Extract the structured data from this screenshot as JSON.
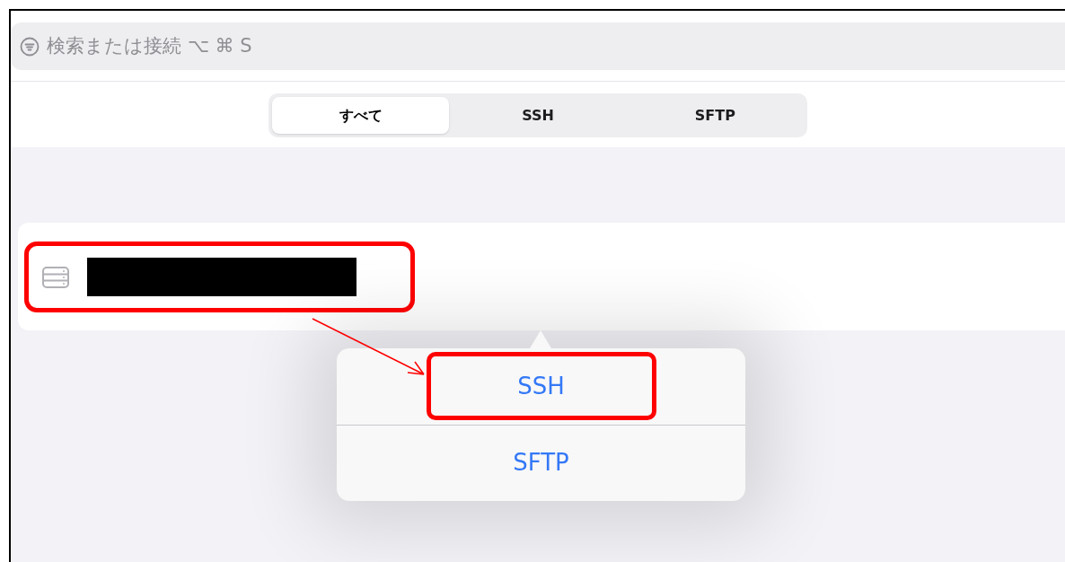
{
  "search": {
    "placeholder": "検索または接続 ⌥ ⌘ S"
  },
  "tabs": [
    {
      "label": "すべて",
      "selected": true
    },
    {
      "label": "SSH",
      "selected": false
    },
    {
      "label": "SFTP",
      "selected": false
    }
  ],
  "host_row": {
    "redacted": true,
    "annotated": true
  },
  "menu": {
    "items": [
      {
        "label": "SSH",
        "annotated": true
      },
      {
        "label": "SFTP",
        "annotated": false
      }
    ]
  }
}
